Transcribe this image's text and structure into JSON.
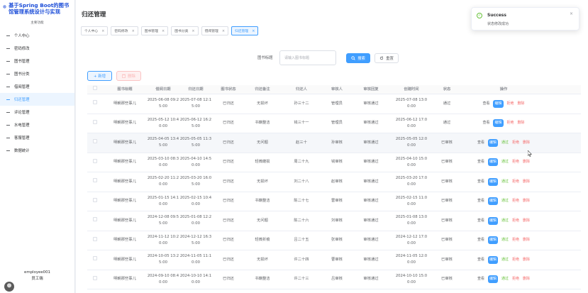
{
  "brand": {
    "title": "基于Spring Boot的图书馆管理系统设计与实现"
  },
  "sidebar": {
    "section_label": "主要功能",
    "items": [
      {
        "label": "个人中心"
      },
      {
        "label": "密码修改"
      },
      {
        "label": "图书管理"
      },
      {
        "label": "图书分类"
      },
      {
        "label": "借阅管理"
      },
      {
        "label": "归还管理",
        "active": true
      },
      {
        "label": "评论管理"
      },
      {
        "label": "水电管理"
      },
      {
        "label": "客服管理"
      },
      {
        "label": "数据统计"
      }
    ],
    "user": {
      "name": "employee001",
      "role": "员工端"
    }
  },
  "page": {
    "title": "归还管理"
  },
  "tags": [
    {
      "label": "个人中心"
    },
    {
      "label": "密码修改"
    },
    {
      "label": "图书管理"
    },
    {
      "label": "图书分类"
    },
    {
      "label": "借阅管理"
    },
    {
      "label": "归还管理",
      "active": true
    }
  ],
  "filter": {
    "label": "图书标题",
    "placeholder": "请输入图书标题"
  },
  "buttons": {
    "search": "搜索",
    "reset": "重置",
    "add": "+ 新增",
    "delete": "删除"
  },
  "table": {
    "headers": [
      "",
      "图书标题",
      "借阅日期",
      "归还日期",
      "图书状态",
      "归还备注",
      "归还人",
      "审核人",
      "审核回复",
      "创建时间",
      "状态",
      "操作"
    ],
    "rows": [
      {
        "title": "明朝那些事儿",
        "borrow": "2025-06-08 09:2\n5:00",
        "return": "2025-07-08 12:1\n5:00",
        "book_status": "已归还",
        "note": "无损坏",
        "returner": "孙三十二",
        "reviewer": "管理员",
        "reply": "审核通过",
        "created": "2025-07-08 13:0\n0:00",
        "status": "通过",
        "ops": [
          "查看",
          "编辑",
          "拒绝",
          "删除"
        ]
      },
      {
        "title": "明朝那些事儿",
        "borrow": "2025-05-12 10:4\n0:00",
        "return": "2025-06-12 16:2\n5:00",
        "book_status": "已归还",
        "note": "书籍整洁",
        "returner": "钱三十一",
        "reviewer": "管理员",
        "reply": "审核通过",
        "created": "2025-06-12 17:0\n0:00",
        "status": "通过",
        "ops": [
          "查看",
          "编辑",
          "拒绝",
          "删除"
        ]
      },
      {
        "title": "明朝那些事儿",
        "borrow": "2025-04-05 13:4\n5:00",
        "return": "2025-05-05 11:3\n5:00",
        "book_status": "已归还",
        "note": "无问题",
        "returner": "赵三十",
        "reviewer": "孙审核",
        "reply": "审核通过",
        "created": "2025-05-05 12:0\n0:00",
        "status": "已审核",
        "ops": [
          "查看",
          "编辑",
          "通过",
          "拒绝",
          "删除"
        ]
      },
      {
        "title": "明朝那些事儿",
        "borrow": "2025-03-10 08:3\n0:00",
        "return": "2025-04-10 14:5\n0:00",
        "book_status": "已归还",
        "note": "轻微磨损",
        "returner": "周二十九",
        "reviewer": "钱审核",
        "reply": "审核通过",
        "created": "2025-04-10 15:0\n0:00",
        "status": "已审核",
        "ops": [
          "查看",
          "编辑",
          "通过",
          "拒绝",
          "删除"
        ]
      },
      {
        "title": "明朝那些事儿",
        "borrow": "2025-02-20 11:2\n0:00",
        "return": "2025-03-20 16:0\n5:00",
        "book_status": "已归还",
        "note": "无损坏",
        "returner": "刘二十八",
        "reviewer": "赵审核",
        "reply": "审核通过",
        "created": "2025-03-20 17:0\n0:00",
        "status": "已审核",
        "ops": [
          "查看",
          "编辑",
          "通过",
          "拒绝",
          "删除"
        ]
      },
      {
        "title": "明朝那些事儿",
        "borrow": "2025-01-15 14:1\n0:00",
        "return": "2025-02-15 10:4\n0:00",
        "book_status": "已归还",
        "note": "书籍整洁",
        "returner": "陈二十七",
        "reviewer": "雷审核",
        "reply": "审核通过",
        "created": "2025-02-15 11:0\n0:00",
        "status": "已审核",
        "ops": [
          "查看",
          "编辑",
          "通过",
          "拒绝",
          "删除"
        ]
      },
      {
        "title": "明朝那些事儿",
        "borrow": "2024-12-08 09:5\n5:00",
        "return": "2025-01-08 12:2\n0:00",
        "book_status": "已归还",
        "note": "无问题",
        "returner": "陈二十六",
        "reviewer": "刘审核",
        "reply": "审核通过",
        "created": "2025-01-08 13:0\n0:00",
        "status": "已审核",
        "ops": [
          "查看",
          "编辑",
          "通过",
          "拒绝",
          "删除"
        ]
      },
      {
        "title": "明朝那些事儿",
        "borrow": "2024-11-12 10:2\n0:00",
        "return": "2024-12-12 16:3\n5:00",
        "book_status": "已归还",
        "note": "轻微折痕",
        "returner": "吕二十五",
        "reviewer": "张审核",
        "reply": "审核通过",
        "created": "2024-12-12 17:0\n0:00",
        "status": "已审核",
        "ops": [
          "查看",
          "编辑",
          "通过",
          "拒绝",
          "删除"
        ]
      },
      {
        "title": "明朝那些事儿",
        "borrow": "2024-10-05 13:2\n5:00",
        "return": "2024-11-05 11:1\n0:00",
        "book_status": "已归还",
        "note": "无损坏",
        "returner": "许二十四",
        "reviewer": "曹审核",
        "reply": "审核通过",
        "created": "2024-11-05 12:0\n0:00",
        "status": "已审核",
        "ops": [
          "查看",
          "编辑",
          "通过",
          "拒绝",
          "删除"
        ]
      },
      {
        "title": "明朝那些事儿",
        "borrow": "2024-09-10 08:4\n0:00",
        "return": "2024-10-10 14:1\n0:00",
        "book_status": "已归还",
        "note": "书籍整洁",
        "returner": "许二十三",
        "reviewer": "吕审核",
        "reply": "审核通过",
        "created": "2024-10-10 15:0\n0:00",
        "status": "已审核",
        "ops": [
          "查看",
          "编辑",
          "通过",
          "拒绝",
          "删除"
        ]
      }
    ]
  },
  "toast": {
    "title": "Success",
    "message": "状态修改成功"
  },
  "colors": {
    "primary": "#409eff",
    "success": "#67c23a",
    "danger": "#f56c6c"
  }
}
